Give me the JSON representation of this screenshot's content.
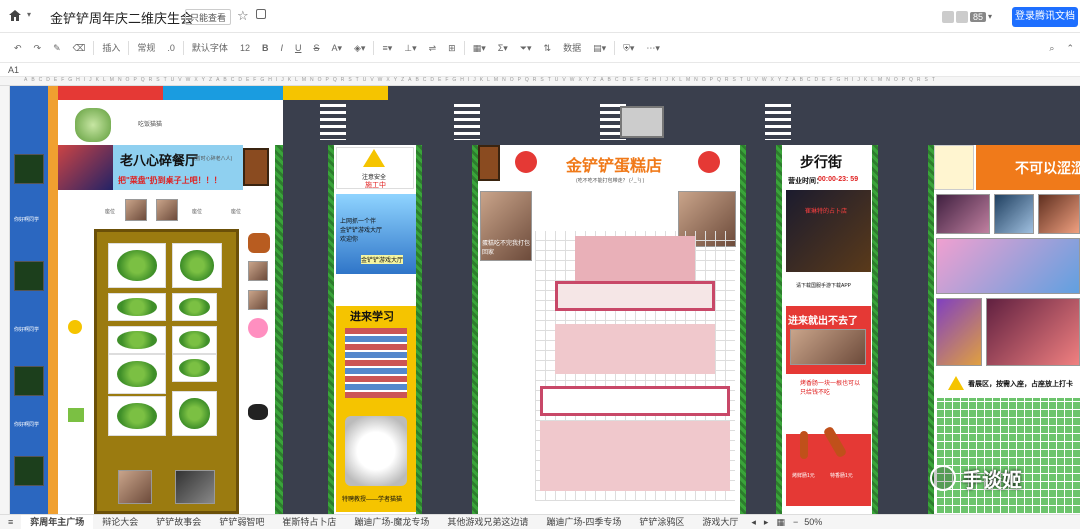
{
  "titlebar": {
    "title": "金铲铲周年庆二维庆生会",
    "mode_badge": "只能查看",
    "collaborator_count": "85",
    "login_button": "登录腾讯文档"
  },
  "toolbar": {
    "items": [
      "插入",
      "常规",
      ".0",
      "默认字体",
      "12",
      "B",
      "I",
      "U",
      "S",
      "数据"
    ]
  },
  "formula_bar": {
    "cell_ref": "A1"
  },
  "canvas": {
    "left_labels": [
      "吃饭猫猫",
      "你好啊同学",
      "你好啊同学",
      "你好啊同学"
    ],
    "restaurant": {
      "title": "老八心碎餐厅",
      "subtitle": "(暂时心碎老八人)",
      "note": "把\"菜盘\"扔到桌子上吧！！！",
      "seat": "座位"
    },
    "warning": {
      "title": "注意安全",
      "subtitle": "施工中"
    },
    "hall": {
      "line1": "上网抓一个伴",
      "line2": "金铲铲游戏大厅",
      "line3": "欢迎你",
      "chat": "金铲铲游戏大厅"
    },
    "study": {
      "title": "进来学习",
      "footer": "特聘教授——学者猫猫"
    },
    "cake_shop": {
      "title": "金铲铲蛋糕店",
      "subtitle": "(吃不吃不能打包带走？ (╯_╰) )",
      "photo_caption": "蛋糕吃不完我打包回家"
    },
    "street": {
      "title": "步行街",
      "hours_label": "营业时间：",
      "hours_value": "00:00-23: 59",
      "shop": "崔琳特的占卜店",
      "download": "请下载国服手游下载APP"
    },
    "escape": {
      "title": "进来就出不去了",
      "bbq": "烤香肠一块一根也可以只给钱不吃",
      "sausage1": "烤鲜肠1元",
      "sausage2": "特香肠1元"
    },
    "right_zone": {
      "title": "不可以涩涩",
      "notice": "看展区，按需入座，占座放上打卡"
    },
    "watermark": "手谈姬"
  },
  "sheet_tabs": [
    "弈周年主广场",
    "辩论大会",
    "铲铲故事会",
    "铲铲弱智吧",
    "崔斯特占卜店",
    "蹦迪广场-魔龙专场",
    "其他游戏兄弟这边请",
    "蹦迪广场-四季专场",
    "铲铲涂鸦区",
    "游戏大厅"
  ],
  "zoom": "50%"
}
